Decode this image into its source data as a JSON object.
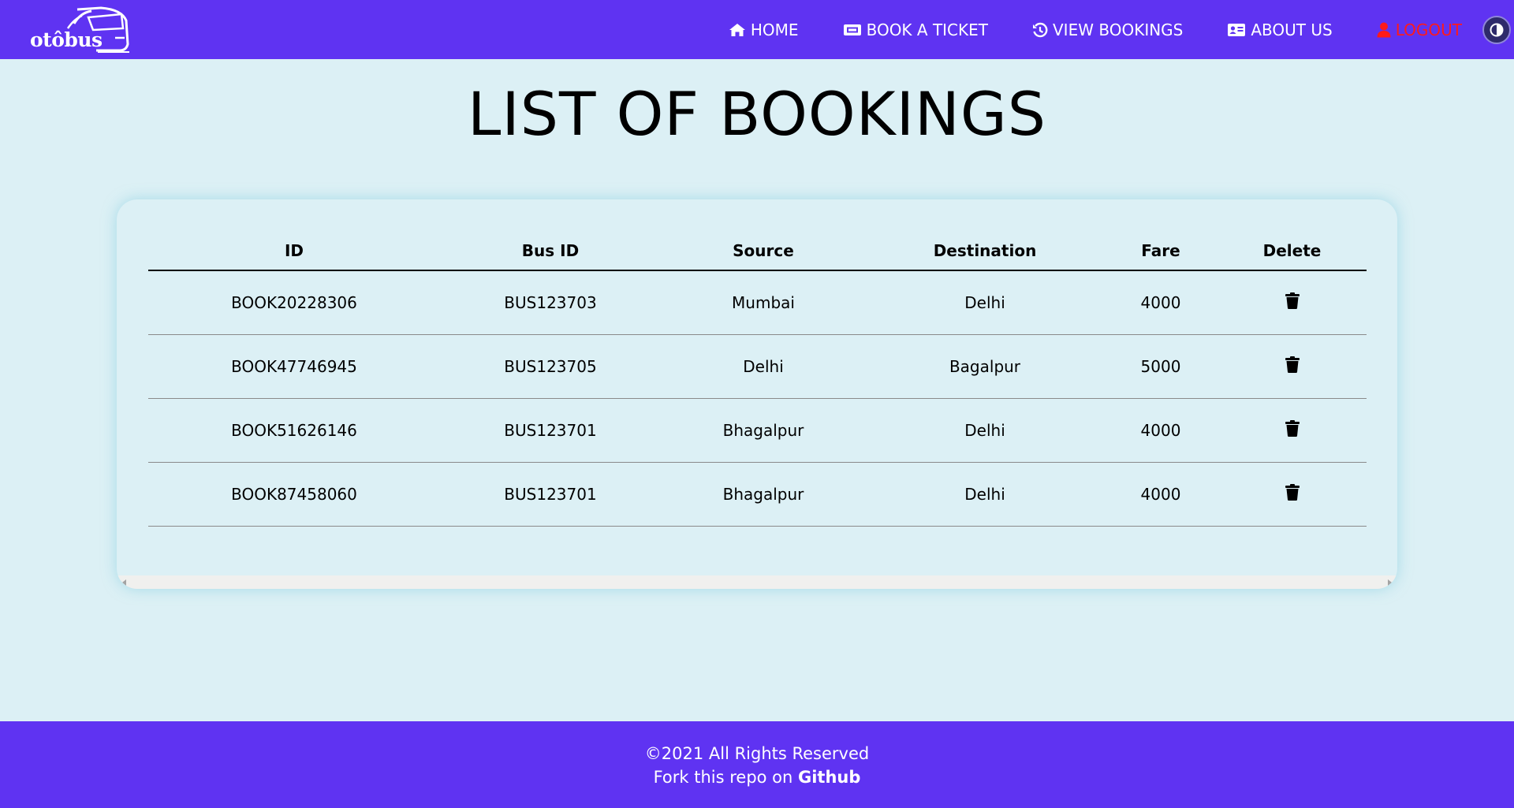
{
  "nav": {
    "logo_text": "otôbus",
    "items": [
      {
        "label": "HOME",
        "icon": "home-icon"
      },
      {
        "label": "BOOK A TICKET",
        "icon": "ticket-icon"
      },
      {
        "label": "VIEW BOOKINGS",
        "icon": "history-icon"
      },
      {
        "label": "ABOUT US",
        "icon": "id-card-icon"
      },
      {
        "label": "LOGOUT",
        "icon": "user-icon"
      }
    ],
    "theme_toggle_icon": "contrast-icon"
  },
  "page": {
    "title": "LIST OF BOOKINGS"
  },
  "table": {
    "headers": [
      "ID",
      "Bus ID",
      "Source",
      "Destination",
      "Fare",
      "Delete"
    ],
    "rows": [
      [
        "BOOK20228306",
        "BUS123703",
        "Mumbai",
        "Delhi",
        "4000"
      ],
      [
        "BOOK47746945",
        "BUS123705",
        "Delhi",
        "Bagalpur",
        "5000"
      ],
      [
        "BOOK51626146",
        "BUS123701",
        "Bhagalpur",
        "Delhi",
        "4000"
      ],
      [
        "BOOK87458060",
        "BUS123701",
        "Bhagalpur",
        "Delhi",
        "4000"
      ]
    ],
    "delete_icon": "trash-icon"
  },
  "footer": {
    "copyright": "©2021 All Rights Reserved",
    "fork_text": "Fork this repo on ",
    "fork_link": "Github"
  },
  "colors": {
    "brand": "#5f33f2",
    "background": "#dcf0f5",
    "logout": "#ff1a1a"
  }
}
